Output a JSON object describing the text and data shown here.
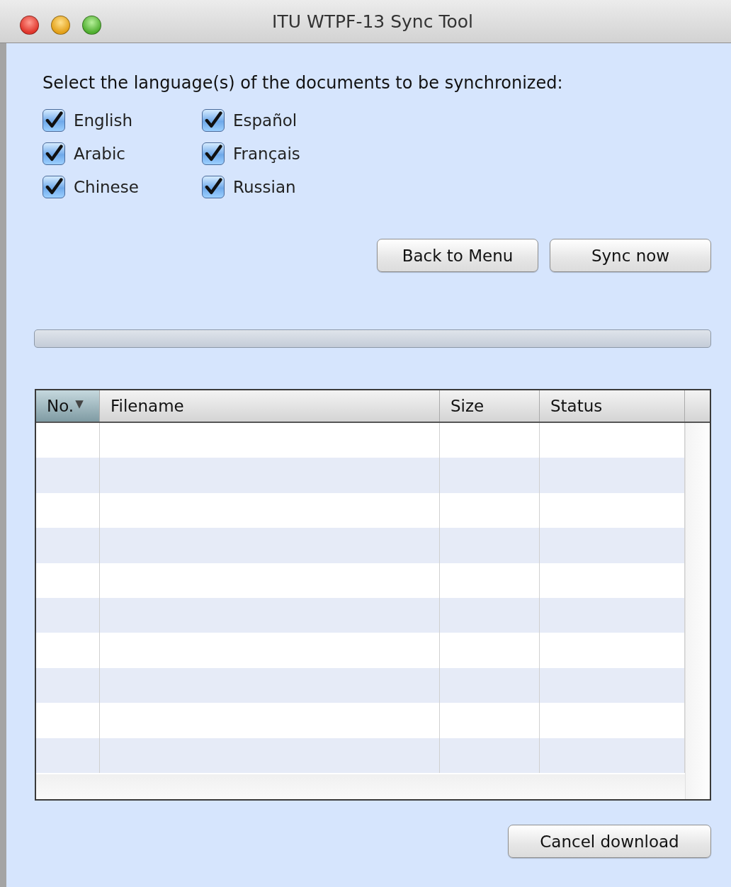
{
  "window": {
    "title": "ITU WTPF-13 Sync Tool"
  },
  "prompt": "Select the language(s) of the documents to be synchronized:",
  "languages": [
    [
      {
        "label": "English",
        "checked": true
      },
      {
        "label": "Arabic",
        "checked": true
      },
      {
        "label": "Chinese",
        "checked": true
      }
    ],
    [
      {
        "label": "Español",
        "checked": true
      },
      {
        "label": "Français",
        "checked": true
      },
      {
        "label": "Russian",
        "checked": true
      }
    ]
  ],
  "buttons": [
    "Back to Menu",
    "Sync now"
  ],
  "progress": {
    "level": 0
  },
  "table": {
    "columns": [
      {
        "label": "No.",
        "sorted": true,
        "sort_indicator": "▼"
      },
      {
        "label": "Filename",
        "sorted": false
      },
      {
        "label": "Size",
        "sorted": false
      },
      {
        "label": "Status",
        "sorted": false
      }
    ]
  },
  "footer_button": "Cancel download"
}
